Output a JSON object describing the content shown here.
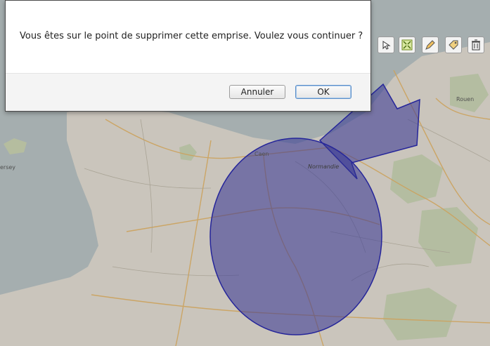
{
  "dialog": {
    "message": "Vous êtes sur le point de supprimer cette emprise. Voulez vous continuer ?",
    "cancel_label": "Annuler",
    "ok_label": "OK"
  },
  "map": {
    "labels": {
      "caen": "Caen",
      "normandie": "Normandie",
      "rouen": "Rouen",
      "jersey": "ersey"
    },
    "shape_color": "#3a3aa8"
  },
  "toolbar": {
    "icons": [
      "select-icon",
      "fullscreen-icon",
      "pencil-icon",
      "tag-icon",
      "trash-icon"
    ]
  }
}
